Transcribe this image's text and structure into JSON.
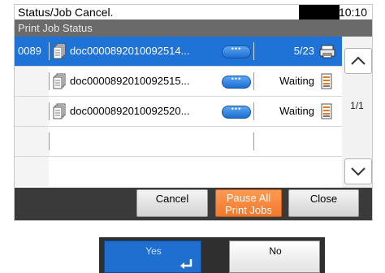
{
  "header": {
    "title": "Status/Job Cancel.",
    "time": "10:10",
    "subtitle": "Print Job Status"
  },
  "jobs": [
    {
      "id": "0089",
      "name": "doc0000892010092514...",
      "status": "5/23",
      "selected": true
    },
    {
      "id": "",
      "name": "doc0000892010092515...",
      "status": "Waiting",
      "selected": false
    },
    {
      "id": "",
      "name": "doc0000892010092520...",
      "status": "Waiting",
      "selected": false
    }
  ],
  "scroll": {
    "page": "1/1"
  },
  "buttons": {
    "cancel": "Cancel",
    "pause_line1": "Pause All",
    "pause_line2": "Print Jobs",
    "close": "Close"
  },
  "dialog": {
    "yes": "Yes",
    "no": "No"
  },
  "colors": {
    "selected_row": "#1f72d6",
    "pause_button": "#f0782c",
    "bottom_bar": "#3a3a3a"
  },
  "icons": [
    "document-stack-icon",
    "detail-pill-icon",
    "printing-icon",
    "waiting-icon",
    "scroll-up-icon",
    "scroll-down-icon",
    "enter-icon"
  ]
}
